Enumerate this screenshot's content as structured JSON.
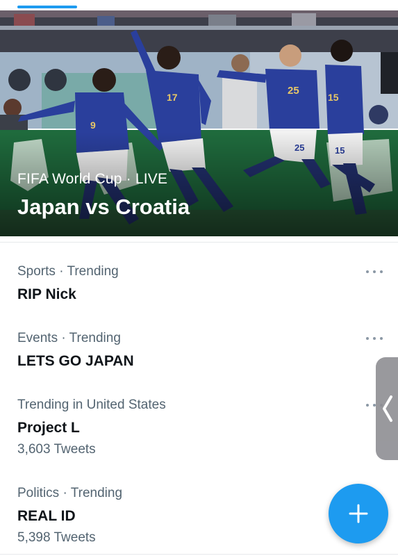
{
  "hero": {
    "meta": "FIFA World Cup · LIVE",
    "title": "Japan vs Croatia"
  },
  "trends": [
    {
      "meta": "Sports · Trending",
      "name": "RIP Nick",
      "count": ""
    },
    {
      "meta": "Events · Trending",
      "name": "LETS GO JAPAN",
      "count": ""
    },
    {
      "meta": "Trending in United States",
      "name": "Project L",
      "count": "3,603 Tweets"
    },
    {
      "meta": "Politics · Trending",
      "name": "REAL ID",
      "count": "5,398 Tweets"
    }
  ],
  "colors": {
    "accent": "#1d9bf0",
    "secondary_text": "#536471",
    "primary_text": "#0f1419",
    "jersey": "#2a3f9c",
    "pitch": "#2b5e3a"
  },
  "icons": {
    "more": "more-horizontal-icon",
    "side_tab": "chevron-left-icon",
    "compose": "plus-icon"
  }
}
